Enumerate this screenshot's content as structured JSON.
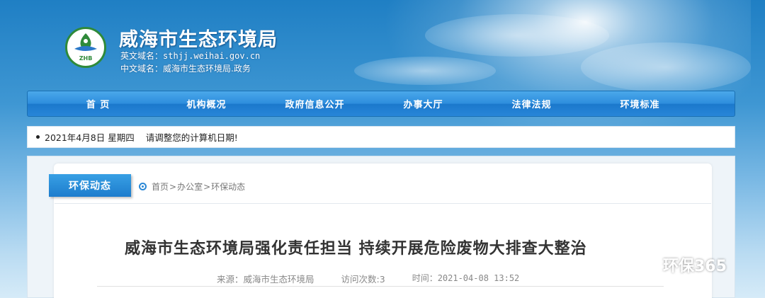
{
  "header": {
    "site_title": "威海市生态环境局",
    "logo_text": "ZHB",
    "en_domain_label": "英文域名：",
    "en_domain_value": "sthjj.weihai.gov.cn",
    "cn_domain_label": "中文域名：",
    "cn_domain_value": "威海市生态环境局.政务"
  },
  "nav": {
    "items": [
      {
        "label": "首  页"
      },
      {
        "label": "机构概况"
      },
      {
        "label": "政府信息公开"
      },
      {
        "label": "办事大厅"
      },
      {
        "label": "法律法规"
      },
      {
        "label": "环境标准"
      }
    ]
  },
  "datebar": {
    "date": "2021年4月8日 星期四",
    "notice": "请调整您的计算机日期!"
  },
  "section": {
    "tab_label": "环保动态",
    "breadcrumb": [
      "首页",
      "办公室",
      "环保动态"
    ],
    "breadcrumb_sep": ">"
  },
  "article": {
    "title": "威海市生态环境局强化责任担当  持续开展危险废物大排查大整治",
    "source": "来源：威海市生态环境局",
    "visits": "访问次数:3",
    "time": "时间：2021-04-08 13:52"
  },
  "watermark": {
    "text": "环保365",
    "icon": "wechat-icon"
  },
  "colors": {
    "nav_blue": "#2d8ddd",
    "logo_green": "#2f8a3a",
    "tab_blue": "#1d7ccd"
  }
}
